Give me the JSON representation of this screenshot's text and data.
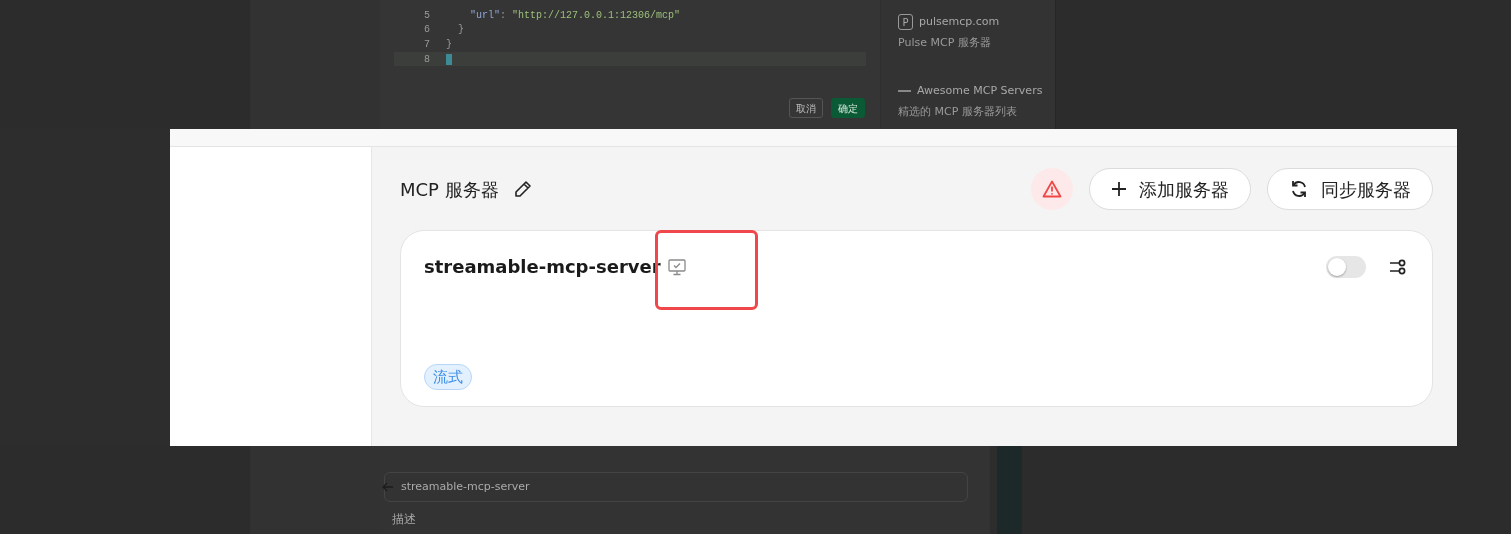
{
  "background": {
    "editor_lines": [
      {
        "number": "5",
        "key": "    \"url\"",
        "separator": ":",
        "value": "\"http://127.0.0.1:12306/mcp\""
      },
      {
        "number": "6",
        "code": "  }"
      },
      {
        "number": "7",
        "code": "}"
      },
      {
        "number": "8",
        "cursor": true
      }
    ],
    "dialog_buttons": [
      {
        "label": "取消",
        "kind": "cancel"
      },
      {
        "label": "确定",
        "kind": "confirm"
      }
    ],
    "resources": [
      {
        "title": "pulsemcp.com",
        "description": "Pulse MCP 服务器",
        "kind": "letter",
        "glyph": "P"
      },
      {
        "title": "Awesome MCP Servers",
        "description": "精选的 MCP 服务器列表",
        "kind": "dash"
      }
    ],
    "form": {
      "name_value": "streamable-mcp-server",
      "label": "描述"
    }
  },
  "panel": {
    "title": "MCP 服务器",
    "warning": true,
    "actions": [
      {
        "label": "添加服务器",
        "kind": "add"
      },
      {
        "label": "同步服务器",
        "kind": "sync"
      }
    ],
    "servers": [
      {
        "name": "streamable-mcp-server",
        "enabled": false,
        "tags": [
          "流式"
        ]
      }
    ]
  }
}
